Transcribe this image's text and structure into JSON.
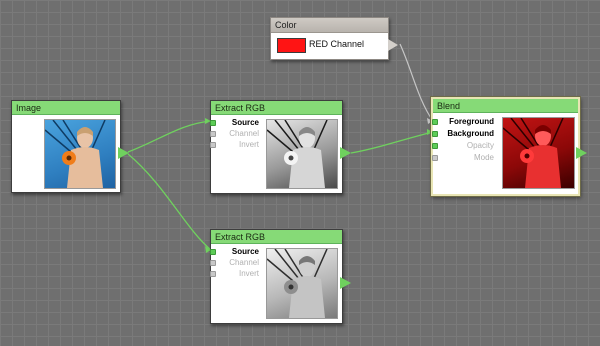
{
  "nodes": {
    "image": {
      "title": "Image"
    },
    "extract_rgb_1": {
      "title": "Extract RGB",
      "ports": [
        "Source",
        "Channel",
        "Invert"
      ]
    },
    "extract_rgb_2": {
      "title": "Extract RGB",
      "ports": [
        "Source",
        "Channel",
        "Invert"
      ]
    },
    "color": {
      "title": "Color",
      "value_label": "RED Channel",
      "swatch_color": "#ff1414"
    },
    "blend": {
      "title": "Blend",
      "ports": [
        "Foreground",
        "Background",
        "Opacity",
        "Mode"
      ]
    }
  },
  "colors": {
    "node_header": "#86da77",
    "wire": "#6fd15e",
    "canvas": "#6f6f6f",
    "selection_border": "#e8e5b4"
  }
}
